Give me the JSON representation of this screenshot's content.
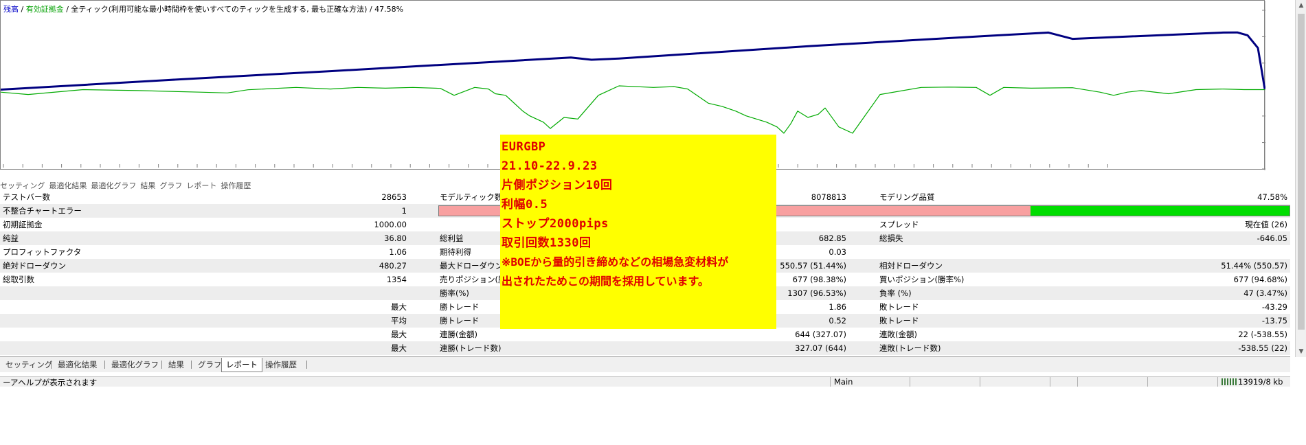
{
  "chart": {
    "legend": {
      "balance": "残高",
      "sep1": " / ",
      "equity": "有効証拠金",
      "sep2": " / ",
      "mode": "全ティック(利用可能な最小時間枠を使いすべてのティックを生成する, 最も正確な方法)",
      "sep3": " / ",
      "quality": "47.58%"
    },
    "colors": {
      "balance": "#000080",
      "equity": "#00aa00",
      "grid": "#d8d8d8"
    }
  },
  "chart_data": {
    "type": "line",
    "x_ticks": [
      "0",
      "26",
      "50",
      "73",
      "97",
      "120",
      "143",
      "167",
      "190",
      "214",
      "237",
      "260",
      "284",
      "307",
      "331",
      "354",
      "377",
      "401",
      "424",
      "448",
      "471",
      "494",
      "518",
      "541",
      "564",
      "588",
      "611",
      "634",
      "658",
      "681",
      "704",
      "728",
      "751",
      "774",
      "798",
      "821",
      "846",
      "869",
      "892",
      "916",
      "939",
      "963",
      "986",
      "1009",
      "1033",
      "1056",
      "1080",
      "1103",
      "1127",
      "1150",
      "1173",
      "1197",
      "1220",
      "1244",
      "1267",
      "1290",
      "1314",
      "1337"
    ],
    "y_ticks": [
      "1538",
      "1371",
      "1204",
      "1036",
      "869",
      "701",
      "534"
    ],
    "ylim": [
      534,
      1538
    ],
    "xlim": [
      0,
      1354
    ],
    "series": [
      {
        "name": "残高",
        "x": [
          0,
          240,
          480,
          760,
          830,
          860,
          900,
          1180,
          1432,
          1525,
          1560,
          1780,
          1800,
          1815,
          1830,
          1840
        ],
        "y": [
          1036,
          1096,
          1153,
          1222,
          1239,
          1225,
          1233,
          1312,
          1375,
          1397,
          1357,
          1397,
          1398,
          1380,
          1300,
          1040
        ]
      },
      {
        "name": "有効証拠金",
        "x": [
          0,
          40,
          120,
          200,
          290,
          330,
          360,
          430,
          480,
          520,
          560,
          600,
          640,
          660,
          690,
          710,
          720,
          735,
          745,
          760,
          770,
          780,
          790,
          800,
          820,
          840,
          870,
          900,
          950,
          980,
          1000,
          1020,
          1030,
          1050,
          1070,
          1085,
          1100,
          1115,
          1130,
          1140,
          1150,
          1160,
          1175,
          1190,
          1200,
          1220,
          1240,
          1280,
          1340,
          1380,
          1420,
          1440,
          1460,
          1500,
          1560,
          1600,
          1620,
          1640,
          1660,
          1700,
          1740,
          1780,
          1810,
          1840
        ],
        "y": [
          1020,
          1005,
          1036,
          1030,
          1020,
          1015,
          1035,
          1050,
          1040,
          1050,
          1045,
          1050,
          1044,
          1000,
          1050,
          1040,
          1010,
          1000,
          960,
          900,
          870,
          850,
          830,
          790,
          860,
          850,
          1000,
          1060,
          1050,
          1055,
          1040,
          980,
          950,
          930,
          900,
          870,
          850,
          830,
          800,
          760,
          820,
          900,
          860,
          880,
          920,
          800,
          760,
          1005,
          1050,
          1052,
          1050,
          1000,
          1050,
          1045,
          1048,
          1020,
          1000,
          1020,
          1030,
          1010,
          1036,
          1040,
          1036,
          1036
        ]
      }
    ]
  },
  "tabs_top": [
    "セッティング",
    "最適化結果",
    "最適化グラフ",
    "結果",
    "グラフ",
    "レポート",
    "操作履歴"
  ],
  "report": {
    "r1": {
      "l1": "テストバー数",
      "v1": "28653",
      "l2": "モデルティック数",
      "v2": "8078813",
      "l3": "モデリング品質",
      "v3": "47.58%"
    },
    "r2": {
      "l1": "不整合チャートエラー",
      "v1": "1",
      "quality_ratio": 0.4758
    },
    "r3": {
      "l1": "初期証拠金",
      "v1": "1000.00",
      "l3": "スプレッド",
      "v3": "現在値 (26)"
    },
    "r4": {
      "l1": "純益",
      "v1": "36.80",
      "l2": "総利益",
      "v2": "682.85",
      "l3": "総損失",
      "v3": "-646.05"
    },
    "r5": {
      "l1": "プロフィットファクタ",
      "v1": "1.06",
      "l2": "期待利得",
      "v2": "0.03"
    },
    "r6": {
      "l1": "絶対ドローダウン",
      "v1": "480.27",
      "l2": "最大ドローダウン",
      "v2": "550.57 (51.44%)",
      "l3": "相対ドローダウン",
      "v3": "51.44% (550.57)"
    },
    "r7": {
      "l1": "総取引数",
      "v1": "1354",
      "l2": "売りポジション(勝率",
      "v2": "677 (98.38%)",
      "l3": "買いポジション(勝率%)",
      "v3": "677 (94.68%)"
    },
    "r8": {
      "l2": "勝率(%)",
      "v2": "1307 (96.53%)",
      "l3": "負率 (%)",
      "v3": "47 (3.47%)"
    },
    "r9": {
      "v1": "最大",
      "l2": "勝トレード",
      "v2": "1.86",
      "l3": "敗トレード",
      "v3": "-43.29"
    },
    "r10": {
      "v1": "平均",
      "l2": "勝トレード",
      "v2": "0.52",
      "l3": "敗トレード",
      "v3": "-13.75"
    },
    "r11": {
      "v1": "最大",
      "l2": "連勝(金額)",
      "v2": "644 (327.07)",
      "l3": "連敗(金額)",
      "v3": "22 (-538.55)"
    },
    "r12": {
      "v1": "最大",
      "l2": "連勝(トレード数)",
      "v2": "327.07 (644)",
      "l3": "連敗(トレード数)",
      "v3": "-538.55 (22)"
    }
  },
  "tabs_bottom": {
    "setting": "セッティング",
    "opt_results": "最適化結果",
    "opt_graph": "最適化グラフ",
    "results": "結果",
    "graph": "グラフ",
    "report": "レポート",
    "history": "操作履歴"
  },
  "status": {
    "help": "ーアヘルプが表示されます",
    "profile": "Main",
    "traffic": "13919/8 kb"
  },
  "note": {
    "line1": "EURGBP",
    "line2": "21.10-22.9.23",
    "line3": "片側ポジション10回",
    "line4": "利幅0.5",
    "line5": "ストップ2000pips",
    "line6": "取引回数1330回",
    "line7": "※BOEから量的引き締めなどの相場急変材料が",
    "line8": "出されたためこの期間を採用しています。"
  },
  "scrollbar": {
    "up": "▲",
    "down": "▼"
  }
}
